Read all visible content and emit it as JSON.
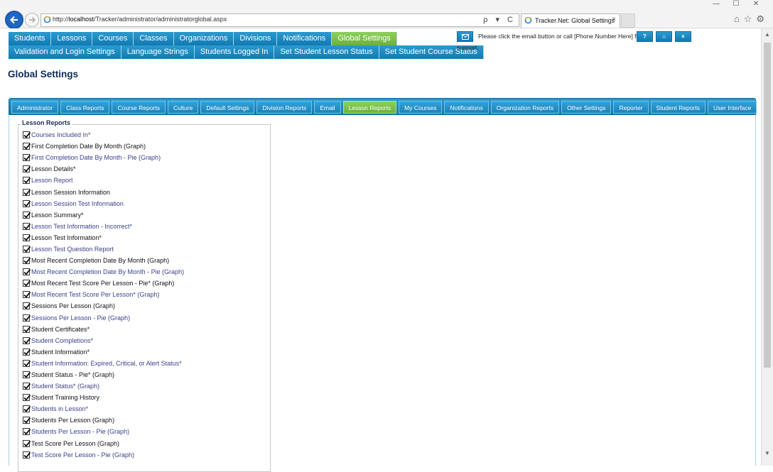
{
  "browser": {
    "url_prefix": "http://",
    "url_host": "localhost",
    "url_path": "/Tracker/administrator/administratorglobal.aspx",
    "url_tools": "ρ ▾ C",
    "tab_title": "Tracker.Net: Global Settings",
    "tab_close": "×",
    "win_minimize": "—",
    "win_maximize": "☐",
    "win_close": "✕"
  },
  "nav": {
    "row1": [
      "Students",
      "Lessons",
      "Courses",
      "Classes",
      "Organizations",
      "Divisions",
      "Notifications",
      "Global Settings"
    ],
    "row2": [
      "Validation and Login Settings",
      "Language Strings",
      "Students Logged In",
      "Set Student Lesson Status",
      "Set Student Course Status"
    ],
    "active": "Global Settings"
  },
  "support": {
    "message": "Please click the email button or call [Phone Number Here] for",
    "message_line2": "support.",
    "help_label": "?",
    "home_label": "⌂",
    "close_label": "×"
  },
  "page_title": "Global Settings",
  "tabs": {
    "items": [
      "Administrator",
      "Class Reports",
      "Course Reports",
      "Culture",
      "Default Settings",
      "Division Reports",
      "Email",
      "Lesson Reports",
      "My Courses",
      "Notifications",
      "Organization Reports",
      "Other Settings",
      "Reporter",
      "Student Reports",
      "User Interface"
    ],
    "active": "Lesson Reports"
  },
  "lesson_reports": {
    "legend": "Lesson Reports",
    "items": [
      {
        "label": "Courses Included In*",
        "checked": true,
        "style": "blue"
      },
      {
        "label": "First Completion Date By Month (Graph)",
        "checked": true,
        "style": "dark"
      },
      {
        "label": "First Completion Date By Month - Pie (Graph)",
        "checked": true,
        "style": "blue"
      },
      {
        "label": "Lesson Details*",
        "checked": true,
        "style": "dark"
      },
      {
        "label": "Lesson Report",
        "checked": true,
        "style": "blue"
      },
      {
        "label": "Lesson Session Information",
        "checked": true,
        "style": "dark"
      },
      {
        "label": "Lesson Session Test Information",
        "checked": true,
        "style": "blue"
      },
      {
        "label": "Lesson Summary*",
        "checked": true,
        "style": "dark"
      },
      {
        "label": "Lesson Test Information - Incorrect*",
        "checked": true,
        "style": "blue"
      },
      {
        "label": "Lesson Test Information*",
        "checked": true,
        "style": "dark"
      },
      {
        "label": "Lesson Test Question Report",
        "checked": true,
        "style": "blue"
      },
      {
        "label": "Most Recent Completion Date By Month (Graph)",
        "checked": true,
        "style": "dark"
      },
      {
        "label": "Most Recent Completion Date By Month - Pie (Graph)",
        "checked": true,
        "style": "blue"
      },
      {
        "label": "Most Recent Test Score Per Lesson - Pie* (Graph)",
        "checked": true,
        "style": "dark"
      },
      {
        "label": "Most Recent Test Score Per Lesson* (Graph)",
        "checked": true,
        "style": "blue"
      },
      {
        "label": "Sessions Per Lesson (Graph)",
        "checked": true,
        "style": "dark"
      },
      {
        "label": "Sessions Per Lesson - Pie (Graph)",
        "checked": true,
        "style": "blue"
      },
      {
        "label": "Student Certificates*",
        "checked": true,
        "style": "dark"
      },
      {
        "label": "Student Completions*",
        "checked": true,
        "style": "blue"
      },
      {
        "label": "Student Information*",
        "checked": true,
        "style": "dark"
      },
      {
        "label": "Student Information: Expired, Critical, or Alert Status*",
        "checked": true,
        "style": "blue"
      },
      {
        "label": "Student Status - Pie* (Graph)",
        "checked": true,
        "style": "dark"
      },
      {
        "label": "Student Status* (Graph)",
        "checked": true,
        "style": "blue"
      },
      {
        "label": "Student Training History",
        "checked": true,
        "style": "dark"
      },
      {
        "label": "Students in Lesson*",
        "checked": true,
        "style": "blue"
      },
      {
        "label": "Students Per Lesson (Graph)",
        "checked": true,
        "style": "dark"
      },
      {
        "label": "Students Per Lesson - Pie (Graph)",
        "checked": true,
        "style": "blue"
      },
      {
        "label": "Test Score Per Lesson (Graph)",
        "checked": true,
        "style": "dark"
      },
      {
        "label": "Test Score Per Lesson - Pie (Graph)",
        "checked": true,
        "style": "blue"
      }
    ]
  },
  "colors": {
    "nav_blue": "#1a86c0",
    "active_green": "#7dc14a",
    "title_navy": "#0c2a5a",
    "link_blue": "#3a3f8a"
  }
}
